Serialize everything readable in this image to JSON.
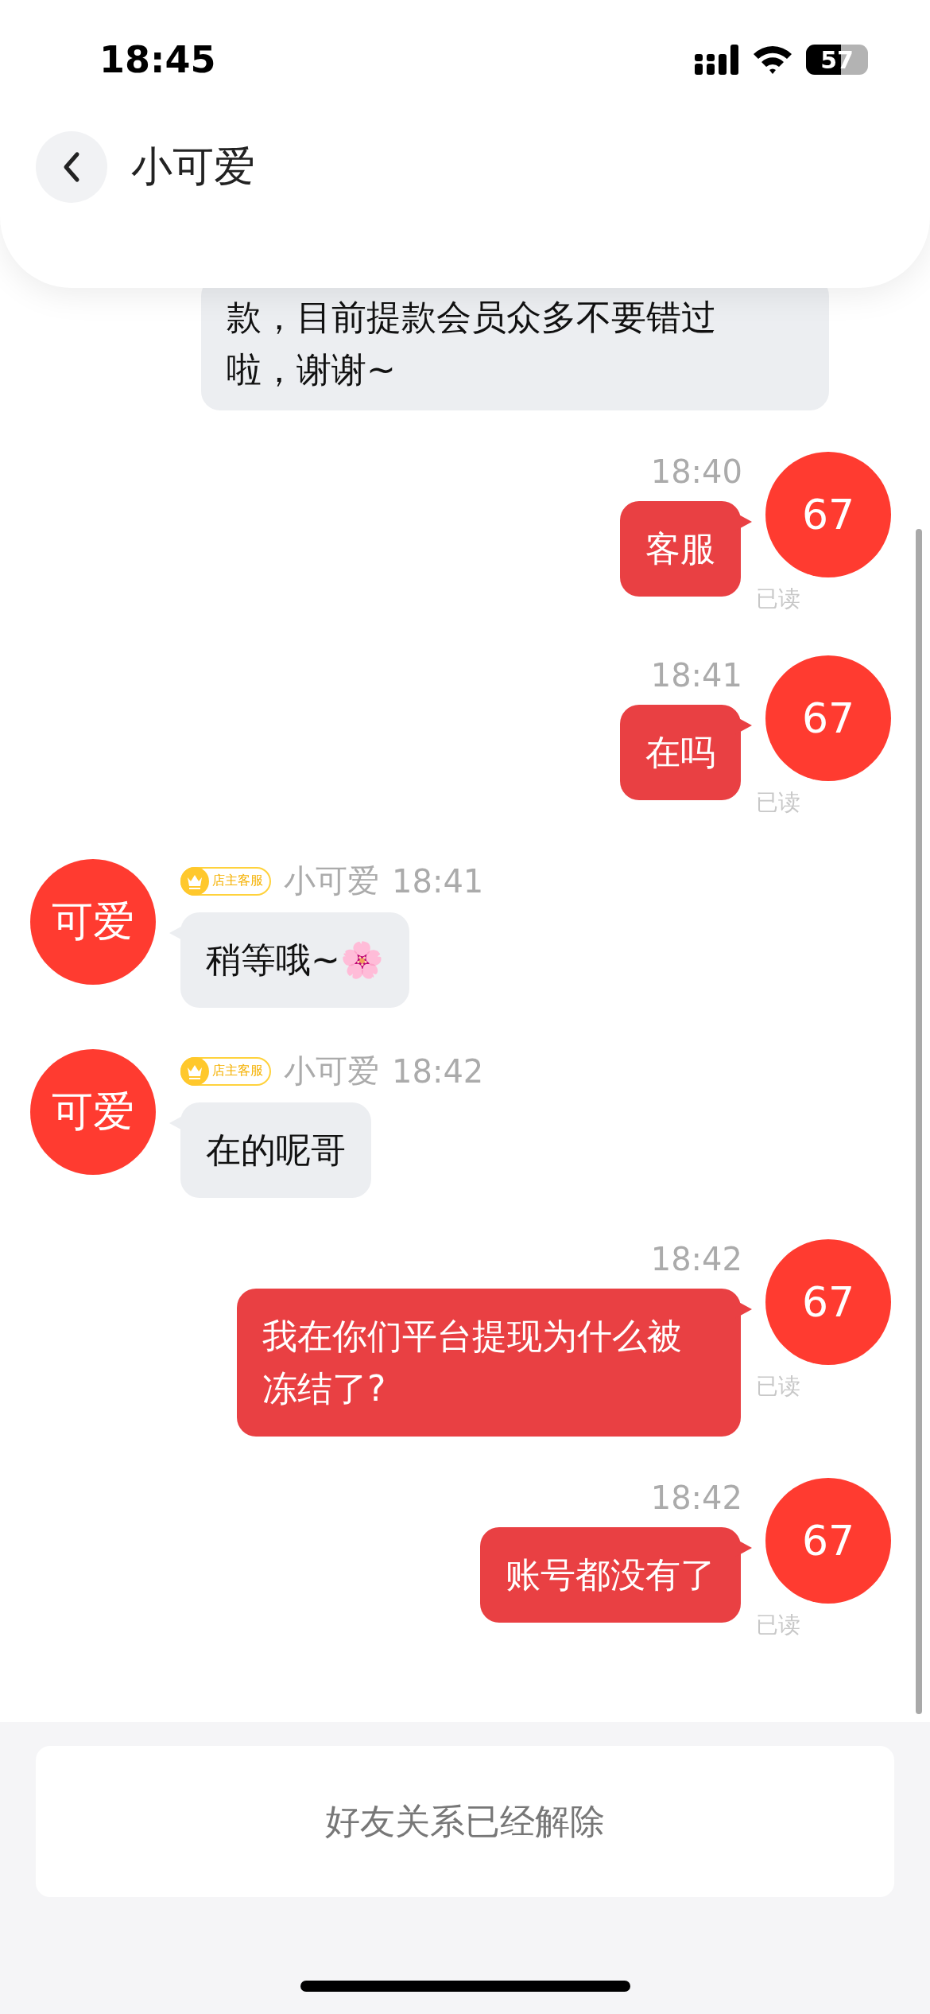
{
  "status_bar": {
    "time": "18:45",
    "battery": "57"
  },
  "header": {
    "title": "小可爱"
  },
  "messages": [
    {
      "kind": "continuation",
      "text": "款，目前提款会员众多不要错过啦，谢谢~"
    },
    {
      "kind": "outgoing",
      "time": "18:40",
      "text": "客服",
      "avatar": "67",
      "receipt": "已读"
    },
    {
      "kind": "outgoing",
      "time": "18:41",
      "text": "在吗",
      "avatar": "67",
      "receipt": "已读"
    },
    {
      "kind": "incoming",
      "avatar": "可爱",
      "badge": "店主客服",
      "sender": "小可爱",
      "time": "18:41",
      "text": "稍等哦~🌸"
    },
    {
      "kind": "incoming",
      "avatar": "可爱",
      "badge": "店主客服",
      "sender": "小可爱",
      "time": "18:42",
      "text": "在的呢哥"
    },
    {
      "kind": "outgoing",
      "time": "18:42",
      "text": "我在你们平台提现为什么被冻结了?",
      "avatar": "67",
      "receipt": "已读"
    },
    {
      "kind": "outgoing",
      "time": "18:42",
      "text": "账号都没有了",
      "avatar": "67",
      "receipt": "已读"
    }
  ],
  "notice": "好友关系已经解除"
}
